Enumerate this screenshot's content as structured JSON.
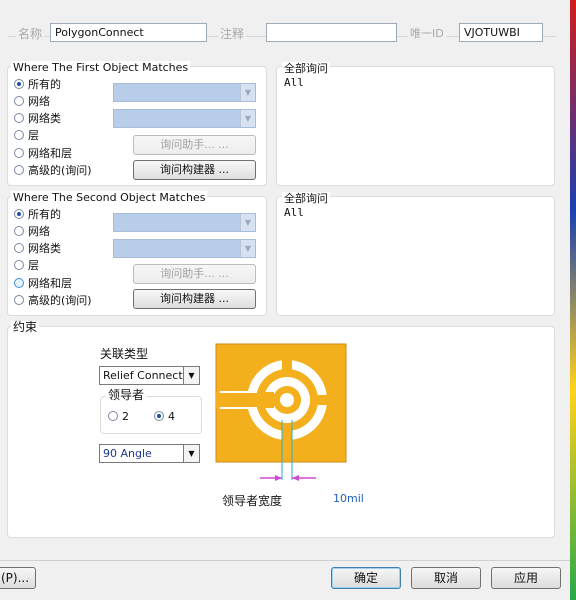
{
  "header": {
    "name_label": "名称",
    "name_value": "PolygonConnect",
    "comment_label": "注释",
    "comment_value": "",
    "uid_label": "唯一ID",
    "uid_value": "VJOTUWBI"
  },
  "first": {
    "title": "Where The First Object Matches",
    "options": [
      "所有的",
      "网络",
      "网络类",
      "层",
      "网络和层",
      "高级的(询问)"
    ],
    "selected_index": 0,
    "helper_button": "询问助手... ...",
    "builder_button": "询问构建器 ...",
    "query_title": "全部询问",
    "query_text": "All"
  },
  "second": {
    "title": "Where The Second Object Matches",
    "options": [
      "所有的",
      "网络",
      "网络类",
      "层",
      "网络和层",
      "高级的(询问)"
    ],
    "selected_index": 0,
    "helper_button": "询问助手... ...",
    "builder_button": "询问构建器 ...",
    "query_title": "全部询问",
    "query_text": "All"
  },
  "constraints": {
    "title": "约束",
    "connect_type_label": "关联类型",
    "connect_type_value": "Relief Connect",
    "conductors_label": "领导者",
    "conductor_options": [
      "2",
      "4"
    ],
    "conductor_selected": "4",
    "angle_value": "90 Angle",
    "conductor_width_label": "领导者宽度",
    "conductor_width_value": "10mil"
  },
  "footer": {
    "left_button": "(P)...",
    "ok_button": "确定",
    "cancel_button": "取消",
    "apply_button": "应用"
  },
  "colors": {
    "pad_orange": "#f4b01c",
    "accent_magenta": "#d048d6",
    "cyan_line": "#2aa8d8"
  }
}
